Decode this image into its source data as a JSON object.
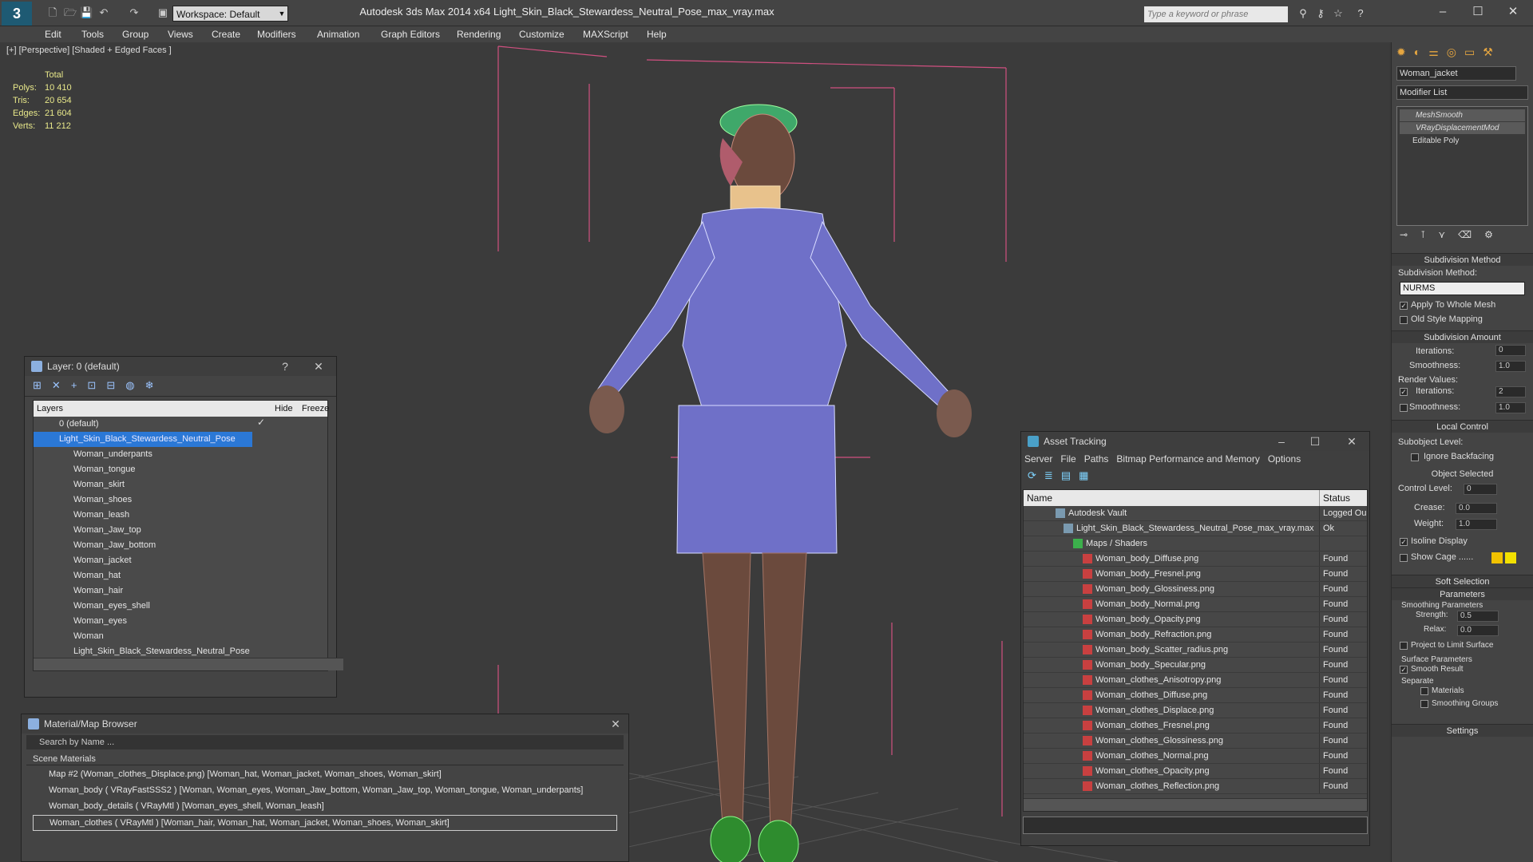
{
  "app": {
    "title": "Autodesk 3ds Max  2014 x64    Light_Skin_Black_Stewardess_Neutral_Pose_max_vray.max",
    "logo": "3",
    "workspace": "Workspace: Default",
    "search_placeholder": "Type a keyword or phrase"
  },
  "menubar": [
    "Edit",
    "Tools",
    "Group",
    "Views",
    "Create",
    "Modifiers",
    "Animation",
    "Graph Editors",
    "Rendering",
    "Customize",
    "MAXScript",
    "Help"
  ],
  "viewport": {
    "label": "[+] [Perspective] [Shaded + Edged Faces ]",
    "stats": {
      "header": "Total",
      "rows": [
        {
          "label": "Polys:",
          "value": "10 410"
        },
        {
          "label": "Tris:",
          "value": "20 654"
        },
        {
          "label": "Edges:",
          "value": "21 604"
        },
        {
          "label": "Verts:",
          "value": "11 212"
        }
      ]
    }
  },
  "layer_dialog": {
    "title": "Layer: 0 (default)",
    "help": "?",
    "col_layers": "Layers",
    "col_hide": "Hide",
    "col_freeze": "Freeze",
    "rows": [
      "0 (default)",
      "Light_Skin_Black_Stewardess_Neutral_Pose",
      "Woman_underpants",
      "Woman_tongue",
      "Woman_skirt",
      "Woman_shoes",
      "Woman_leash",
      "Woman_Jaw_top",
      "Woman_Jaw_bottom",
      "Woman_jacket",
      "Woman_hat",
      "Woman_hair",
      "Woman_eyes_shell",
      "Woman_eyes",
      "Woman",
      "Light_Skin_Black_Stewardess_Neutral_Pose"
    ],
    "selected_row": 1,
    "checked": "✓"
  },
  "material_browser": {
    "title": "Material/Map Browser",
    "search": "Search by Name ...",
    "group": "Scene Materials",
    "items": [
      "Map #2 (Woman_clothes_Displace.png) [Woman_hat, Woman_jacket, Woman_shoes, Woman_skirt]",
      "Woman_body  ( VRayFastSSS2 ) [Woman, Woman_eyes, Woman_Jaw_bottom, Woman_Jaw_top, Woman_tongue, Woman_underpants]",
      "Woman_body_details  ( VRayMtl ) [Woman_eyes_shell, Woman_leash]",
      "Woman_clothes  ( VRayMtl ) [Woman_hair, Woman_hat, Woman_jacket, Woman_shoes, Woman_skirt]"
    ]
  },
  "asset_tracking": {
    "title": "Asset Tracking",
    "menus": [
      "Server",
      "File",
      "Paths",
      "Bitmap Performance and Memory",
      "Options"
    ],
    "col_name": "Name",
    "col_status": "Status",
    "rows": [
      {
        "name": "Autodesk Vault",
        "status": "Logged Ou",
        "indent": 1
      },
      {
        "name": "Light_Skin_Black_Stewardess_Neutral_Pose_max_vray.max",
        "status": "Ok",
        "indent": 2
      },
      {
        "name": "Maps / Shaders",
        "status": "",
        "indent": 3
      },
      {
        "name": "Woman_body_Diffuse.png",
        "status": "Found",
        "indent": 4
      },
      {
        "name": "Woman_body_Fresnel.png",
        "status": "Found",
        "indent": 4
      },
      {
        "name": "Woman_body_Glossiness.png",
        "status": "Found",
        "indent": 4
      },
      {
        "name": "Woman_body_Normal.png",
        "status": "Found",
        "indent": 4
      },
      {
        "name": "Woman_body_Opacity.png",
        "status": "Found",
        "indent": 4
      },
      {
        "name": "Woman_body_Refraction.png",
        "status": "Found",
        "indent": 4
      },
      {
        "name": "Woman_body_Scatter_radius.png",
        "status": "Found",
        "indent": 4
      },
      {
        "name": "Woman_body_Specular.png",
        "status": "Found",
        "indent": 4
      },
      {
        "name": "Woman_clothes_Anisotropy.png",
        "status": "Found",
        "indent": 4
      },
      {
        "name": "Woman_clothes_Diffuse.png",
        "status": "Found",
        "indent": 4
      },
      {
        "name": "Woman_clothes_Displace.png",
        "status": "Found",
        "indent": 4
      },
      {
        "name": "Woman_clothes_Fresnel.png",
        "status": "Found",
        "indent": 4
      },
      {
        "name": "Woman_clothes_Glossiness.png",
        "status": "Found",
        "indent": 4
      },
      {
        "name": "Woman_clothes_Normal.png",
        "status": "Found",
        "indent": 4
      },
      {
        "name": "Woman_clothes_Opacity.png",
        "status": "Found",
        "indent": 4
      },
      {
        "name": "Woman_clothes_Reflection.png",
        "status": "Found",
        "indent": 4
      }
    ]
  },
  "command_panel": {
    "object_name": "Woman_jacket",
    "modifier_list": "Modifier List",
    "stack": [
      "MeshSmooth",
      "VRayDisplacementMod",
      "Editable Poly"
    ],
    "subdivision_method": {
      "title": "Subdivision Method",
      "label": "Subdivision Method:",
      "value": "NURMS",
      "apply": "Apply To Whole Mesh",
      "old": "Old Style Mapping"
    },
    "subdivision_amount": {
      "title": "Subdivision Amount",
      "iterations_label": "Iterations:",
      "iterations": "0",
      "smoothness_label": "Smoothness:",
      "smoothness": "1.0",
      "render_values": "Render Values:",
      "r_iterations": "2",
      "r_smoothness": "1.0"
    },
    "local_control": {
      "title": "Local Control",
      "subobject": "Subobject Level:",
      "ignore": "Ignore Backfacing",
      "selected": "Object Selected",
      "control_level": "Control Level:",
      "control_value": "0",
      "crease": "Crease:",
      "crease_value": "0.0",
      "weight": "Weight:",
      "weight_value": "1.0",
      "isoline": "Isoline Display",
      "cage": "Show Cage ......"
    },
    "soft_selection": "Soft Selection",
    "parameters": {
      "title": "Parameters",
      "smoothing": "Smoothing Parameters",
      "strength": "Strength:",
      "strength_value": "0.5",
      "relax": "Relax:",
      "relax_value": "0.0",
      "project": "Project to Limit Surface",
      "surface": "Surface Parameters",
      "smooth_result": "Smooth Result",
      "separate": "Separate",
      "materials": "Materials",
      "groups": "Smoothing Groups"
    },
    "settings": "Settings"
  },
  "colors": {
    "selection": "#2b78d6",
    "wire_jacket": "#6f70c8",
    "accent_cage": "#f2c200"
  }
}
